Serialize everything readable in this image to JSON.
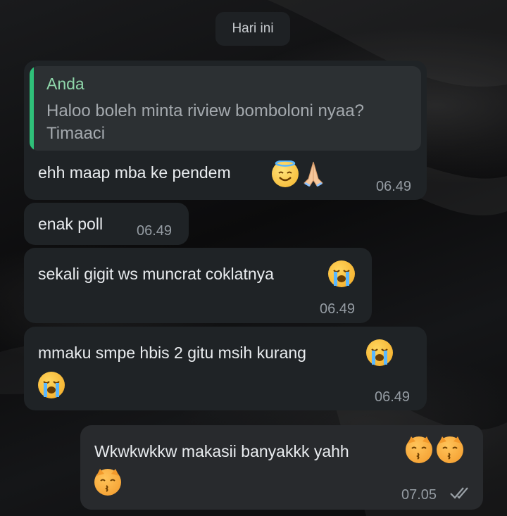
{
  "chat": {
    "date_chip": "Hari ini"
  },
  "messages": [
    {
      "quote": {
        "author": "Anda",
        "text": "Haloo boleh minta riview bomboloni nyaa? Timaaci"
      },
      "text": "ehh maap mba ke pendem",
      "emojis": [
        "smiling-face-with-halo-icon",
        "folded-hands-icon"
      ],
      "time": "06.49"
    },
    {
      "text": "enak poll",
      "time": "06.49"
    },
    {
      "text": "sekali gigit ws muncrat coklatnya",
      "emojis": [
        "loudly-crying-face-icon"
      ],
      "time": "06.49"
    },
    {
      "text": "mmaku smpe hbis 2 gitu msih kurang",
      "emojis": [
        "loudly-crying-face-icon",
        "loudly-crying-face-icon"
      ],
      "time": "06.49"
    },
    {
      "text": "Wkwkwkkw makasii banyakkk yahh",
      "emojis": [
        "kissing-cat-icon",
        "kissing-cat-icon",
        "kissing-cat-icon"
      ],
      "time": "07.05",
      "status": "read-double-check-icon",
      "outgoing": true
    }
  ],
  "colors": {
    "incoming_bubble": "#1f2326",
    "outgoing_bubble": "#282a2d",
    "quote_bar": "#2fc079",
    "quote_author": "#8fd6aa"
  }
}
